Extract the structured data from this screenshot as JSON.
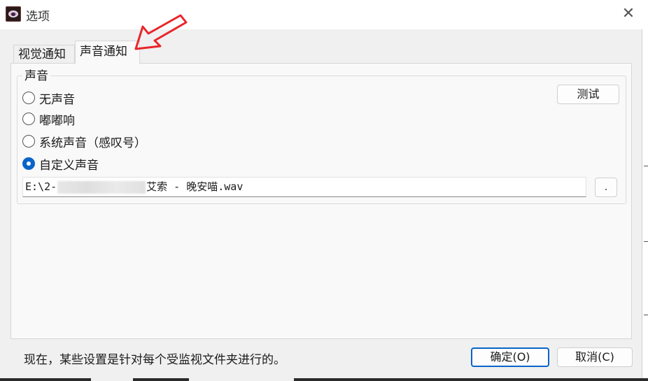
{
  "window": {
    "title": "选项",
    "close_symbol": "✕",
    "app_icon": "eye-icon"
  },
  "tabs": [
    {
      "label": "视觉通知",
      "active": false
    },
    {
      "label": "声音通知",
      "active": true
    }
  ],
  "sound_group": {
    "legend": "声音",
    "options": [
      {
        "label": "无声音",
        "checked": false
      },
      {
        "label": "嘟嘟响",
        "checked": false
      },
      {
        "label": "系统声音（感叹号）",
        "checked": false
      },
      {
        "label": "自定义声音",
        "checked": true
      }
    ],
    "test_button": "测试",
    "path_prefix": "E:\\2-",
    "path_suffix": "艾索 - 晚安喵.wav",
    "browse_button": "."
  },
  "footer": {
    "note": "现在，某些设置是针对每个受监视文件夹进行的。",
    "ok_button": "确定(O)",
    "cancel_button": "取消(C)"
  },
  "colors": {
    "accent": "#0a64c8",
    "annotation_arrow": "#e8262b"
  }
}
